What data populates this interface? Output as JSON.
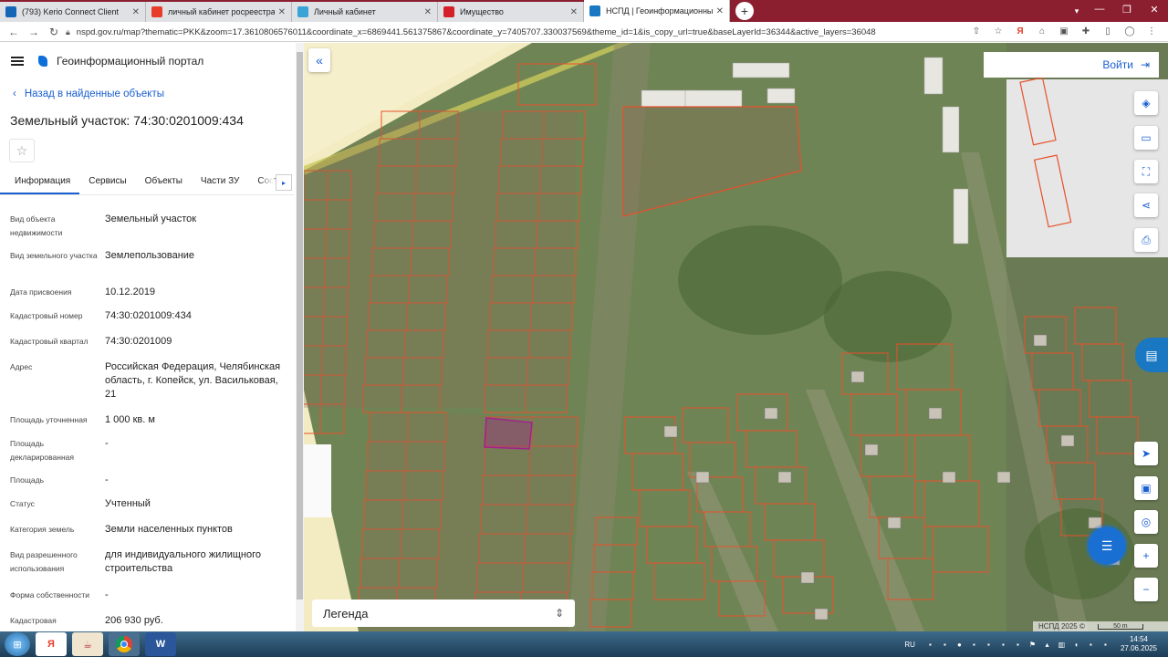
{
  "browser": {
    "tabs": [
      {
        "label": "(793) Kerio Connect Client",
        "favicon": "kerio",
        "color": "#1666b8"
      },
      {
        "label": "личный кабинет росреестра —",
        "favicon": "yandex",
        "color": "#e83c2a"
      },
      {
        "label": "Личный кабинет",
        "favicon": "rosreestr",
        "color": "#3aa3d6"
      },
      {
        "label": "Имущество",
        "favicon": "rtc",
        "color": "#d5202a"
      },
      {
        "label": "НСПД | Геоинформационный п",
        "favicon": "nspd",
        "color": "#1a78c2",
        "active": true
      }
    ],
    "url": "nspd.gov.ru/map?thematic=PKK&zoom=17.3610806576011&coordinate_x=6869441.561375867&coordinate_y=7405707.330037569&theme_id=1&is_copy_url=true&baseLayerId=36344&active_layers=36048"
  },
  "app": {
    "portal_title": "Геоинформационный портал",
    "back_link": "Назад в найденные объекты",
    "object_title": "Земельный участок: 74:30:0201009:434",
    "tabs": [
      "Информация",
      "Сервисы",
      "Объекты",
      "Части ЗУ",
      "Соста"
    ],
    "props": [
      {
        "label": "Вид объекта недвижимости",
        "value": "Земельный участок"
      },
      {
        "label": "Вид земельного участка",
        "value": "Землепользование"
      },
      {
        "label": "Дата присвоения",
        "value": "10.12.2019"
      },
      {
        "label": "Кадастровый номер",
        "value": "74:30:0201009:434"
      },
      {
        "label": "Кадастровый квартал",
        "value": "74:30:0201009"
      },
      {
        "label": "Адрес",
        "value": "Российская Федерация, Челябинская область, г. Копейск, ул. Васильковая, 21"
      },
      {
        "label": "Площадь уточненная",
        "value": "1 000 кв. м"
      },
      {
        "label": "Площадь декларированная",
        "value": "-"
      },
      {
        "label": "Площадь",
        "value": "-"
      },
      {
        "label": "Статус",
        "value": "Учтенный"
      },
      {
        "label": "Категория земель",
        "value": "Земли населенных пунктов"
      },
      {
        "label": "Вид разрешенного использования",
        "value": "для индивидуального жилищного строительства"
      },
      {
        "label": "Форма собственности",
        "value": "-"
      },
      {
        "label": "Кадастровая",
        "value": "206 930 руб."
      }
    ]
  },
  "map": {
    "login": "Войти",
    "legend": "Легенда",
    "copyright": "НСПД 2025 ©",
    "scale": "50 m",
    "parcel_color": "#e8502a",
    "selected_color": "#a0238c"
  },
  "taskbar": {
    "lang": "RU",
    "time": "14:54",
    "date": "27.06.2025"
  }
}
